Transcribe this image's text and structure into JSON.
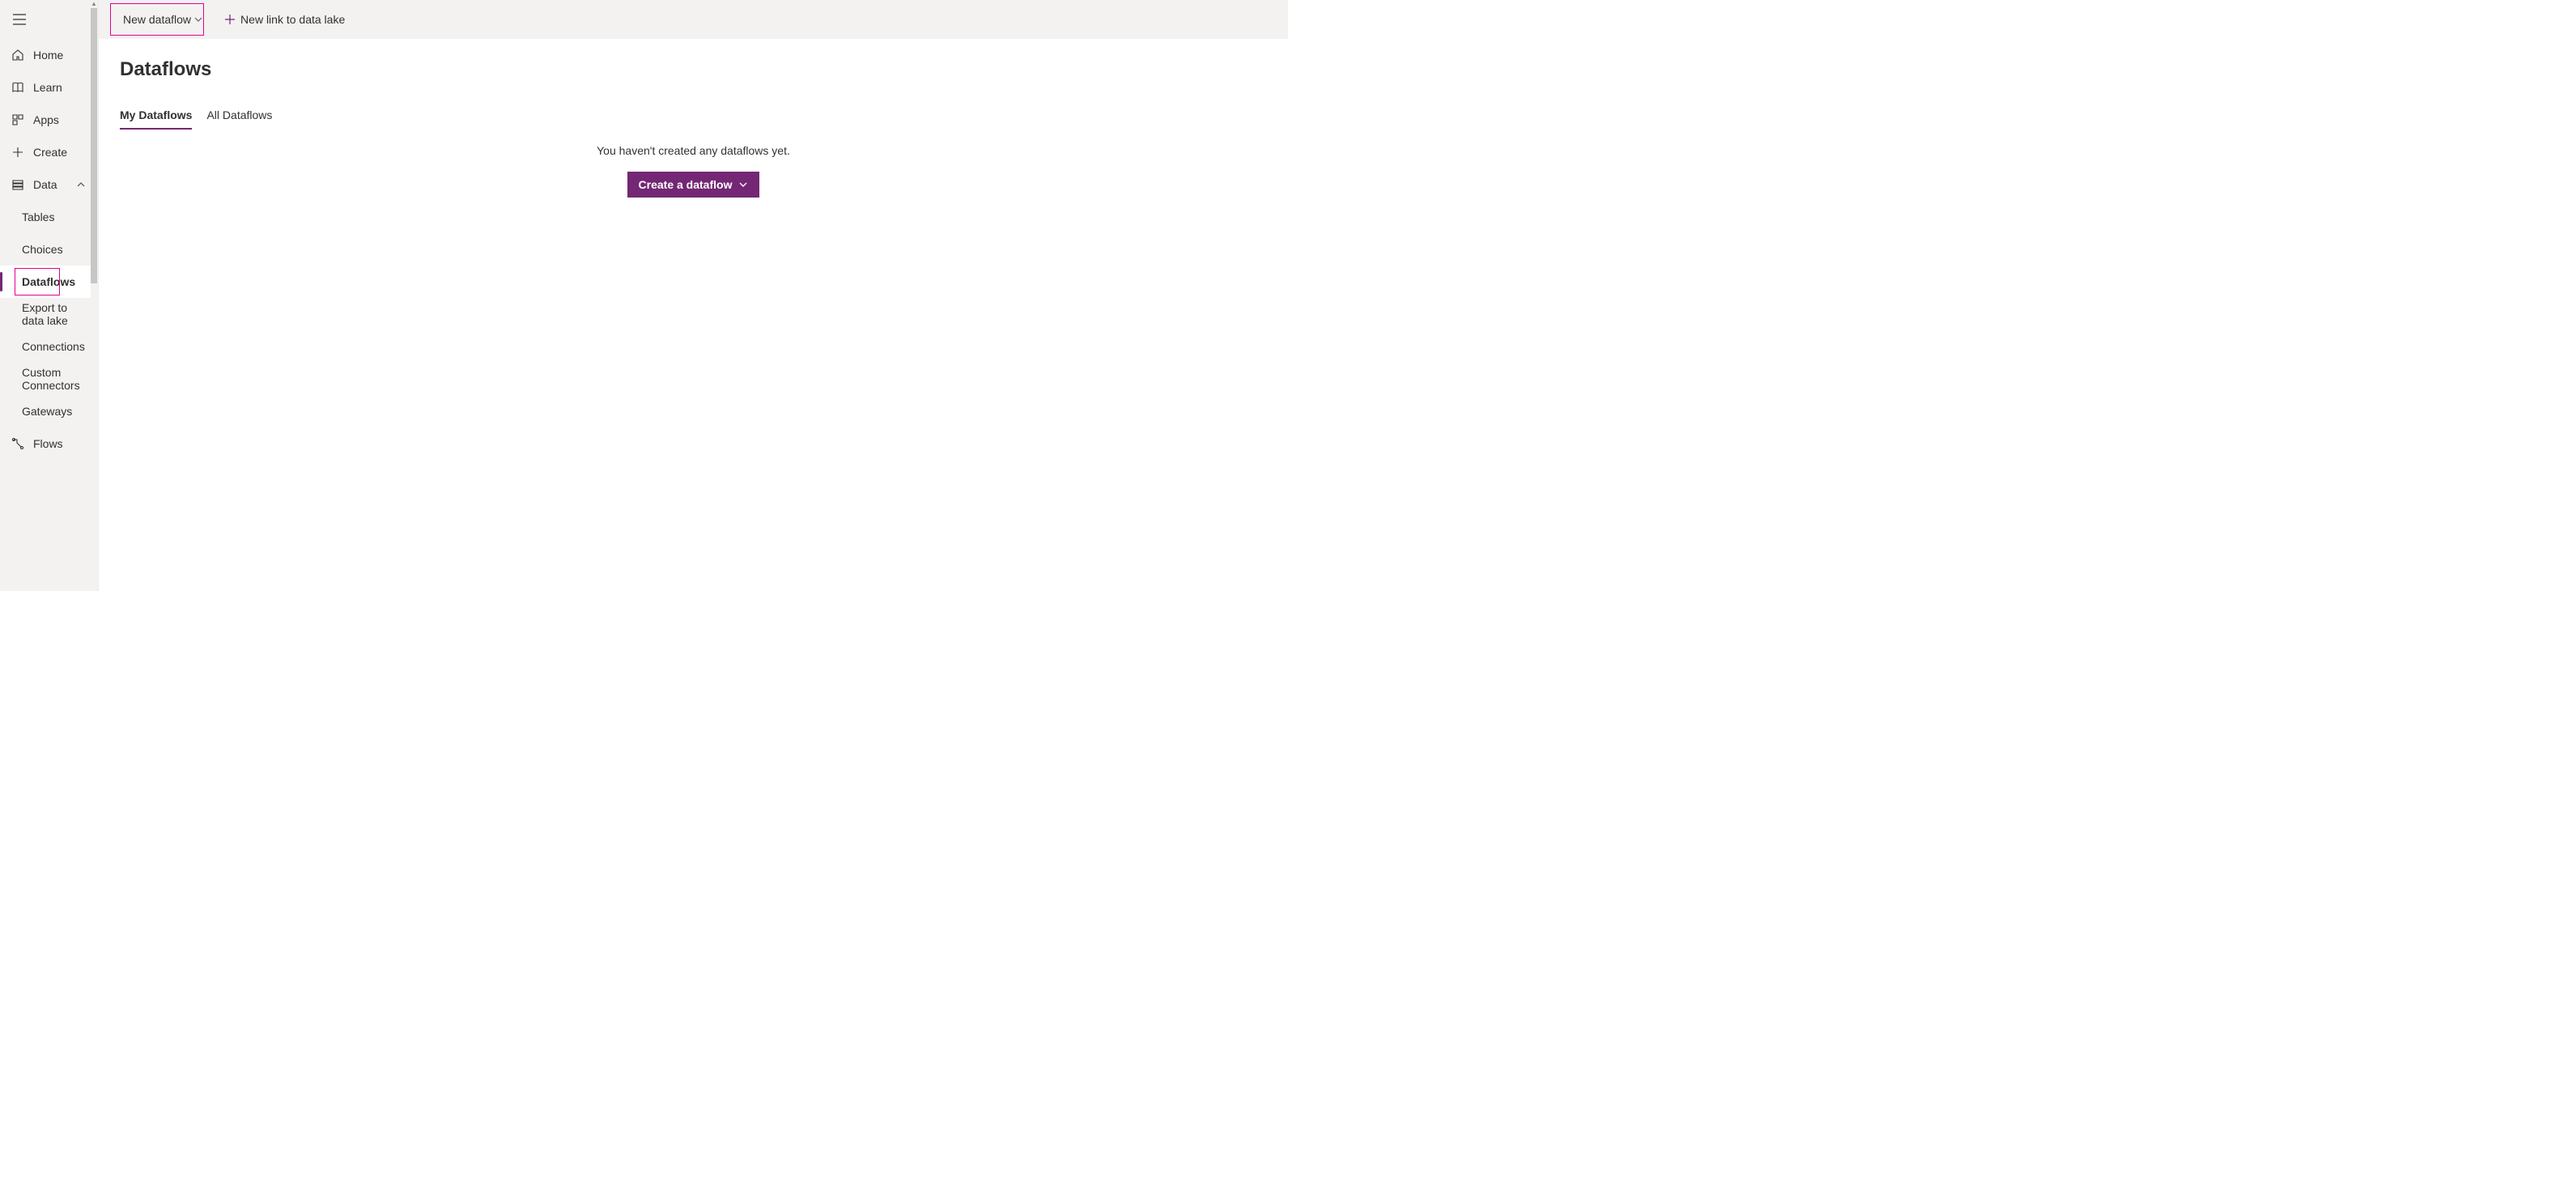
{
  "sidebar": {
    "items": [
      {
        "label": "Home"
      },
      {
        "label": "Learn"
      },
      {
        "label": "Apps"
      },
      {
        "label": "Create"
      },
      {
        "label": "Data"
      }
    ],
    "data_children": [
      {
        "label": "Tables"
      },
      {
        "label": "Choices"
      },
      {
        "label": "Dataflows"
      },
      {
        "label": "Export to data lake"
      },
      {
        "label": "Connections"
      },
      {
        "label": "Custom Connectors"
      },
      {
        "label": "Gateways"
      }
    ],
    "flows_label": "Flows"
  },
  "commandbar": {
    "new_dataflow": "New dataflow",
    "new_link": "New link to data lake"
  },
  "page": {
    "title": "Dataflows",
    "tabs": [
      {
        "label": "My Dataflows"
      },
      {
        "label": "All Dataflows"
      }
    ],
    "empty_text": "You haven't created any dataflows yet.",
    "create_button": "Create a dataflow"
  }
}
